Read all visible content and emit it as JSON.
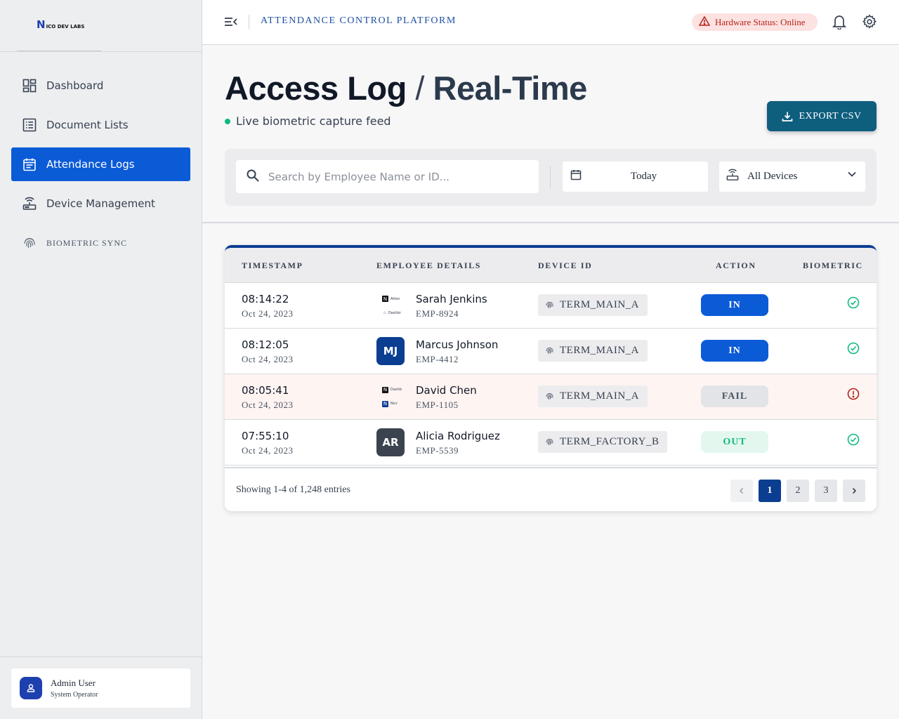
{
  "brand": {
    "logo_text": "ICO DEV LABS",
    "logo_letter": "N"
  },
  "sidebar": {
    "items": [
      {
        "label": "Dashboard",
        "icon": "dashboard-icon"
      },
      {
        "label": "Document Lists",
        "icon": "list-icon"
      },
      {
        "label": "Attendance Logs",
        "icon": "calendar-icon",
        "active": true
      },
      {
        "label": "Device Management",
        "icon": "router-icon"
      },
      {
        "label": "BIOMETRIC SYNC",
        "icon": "fingerprint-icon"
      }
    ],
    "user": {
      "name": "Admin User",
      "role": "System Operator"
    }
  },
  "topbar": {
    "title": "ATTENDANCE CONTROL PLATFORM",
    "hardware_status": "Hardware Status: Online"
  },
  "page": {
    "title_main": "Access Log",
    "title_sep": "/",
    "title_sub": "Real-Time",
    "live_label": "Live biometric capture feed",
    "export_label": "EXPORT CSV"
  },
  "filters": {
    "search_placeholder": "Search by Employee Name or ID...",
    "date_value": "Today",
    "device_value": "All Devices"
  },
  "table": {
    "columns": [
      "TIMESTAMP",
      "EMPLOYEE DETAILS",
      "DEVICE ID",
      "ACTION",
      "BIOMETRIC"
    ],
    "rows": [
      {
        "time": "08:14:22",
        "date": "Oct 24, 2023",
        "name": "Sarah Jenkins",
        "emp_id": "EMP-8924",
        "initials": "",
        "device": "TERM_MAIN_A",
        "action": "IN",
        "biometric": "success"
      },
      {
        "time": "08:12:05",
        "date": "Oct 24, 2023",
        "name": "Marcus Johnson",
        "emp_id": "EMP-4412",
        "initials": "MJ",
        "device": "TERM_MAIN_A",
        "action": "IN",
        "biometric": "success"
      },
      {
        "time": "08:05:41",
        "date": "Oct 24, 2023",
        "name": "David Chen",
        "emp_id": "EMP-1105",
        "initials": "",
        "device": "TERM_MAIN_A",
        "action": "FAIL",
        "biometric": "error"
      },
      {
        "time": "07:55:10",
        "date": "Oct 24, 2023",
        "name": "Alicia Rodriguez",
        "emp_id": "EMP-5539",
        "initials": "AR",
        "device": "TERM_FACTORY_B",
        "action": "OUT",
        "biometric": "success"
      }
    ],
    "avatar_thumb_text": {
      "row0_a": "Atten",
      "row0_b": "Dashbr",
      "row2_a": "Dashb",
      "row2_b": "Nicr"
    },
    "showing": "Showing 1-4 of 1,248 entries",
    "pages": [
      "1",
      "2",
      "3"
    ],
    "current_page": "1"
  },
  "colors": {
    "accent": "#0b5bd7",
    "navy": "#0b3d91",
    "teal": "#0e5e7e",
    "success": "#10b981",
    "error": "#b42318"
  }
}
